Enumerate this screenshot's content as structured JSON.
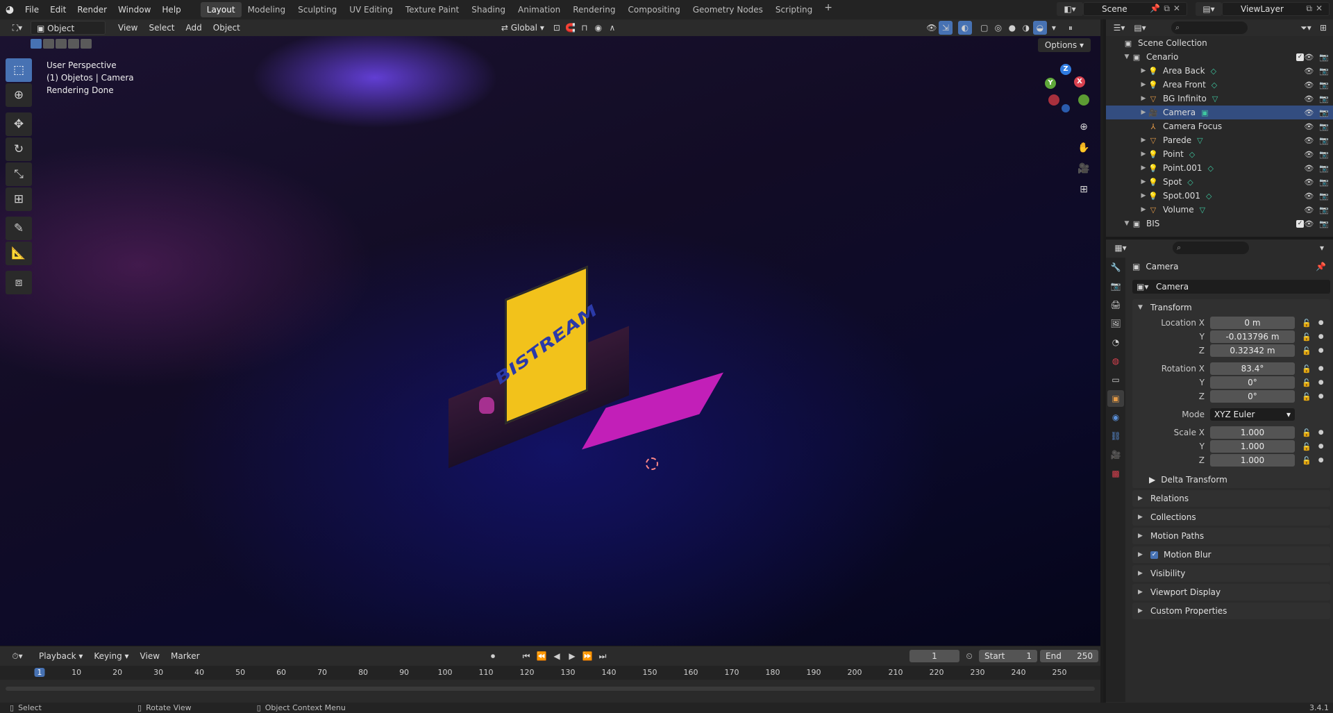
{
  "menus": [
    "File",
    "Edit",
    "Render",
    "Window",
    "Help"
  ],
  "workspaces": [
    "Layout",
    "Modeling",
    "Sculpting",
    "UV Editing",
    "Texture Paint",
    "Shading",
    "Animation",
    "Rendering",
    "Compositing",
    "Geometry Nodes",
    "Scripting"
  ],
  "active_workspace": "Layout",
  "add_workspace": "+",
  "scene": "Scene",
  "view_layer": "ViewLayer",
  "viewport_header": {
    "mode": "Object Mode",
    "menus": [
      "View",
      "Select",
      "Add",
      "Object"
    ],
    "orientation": "Global",
    "options": "Options"
  },
  "viewport_overlay": {
    "line1": "User Perspective",
    "line2": "(1) Objetos | Camera",
    "line3": "Rendering Done"
  },
  "scene_render": {
    "tv_text": "BISTREAM"
  },
  "gizmo": {
    "x": "X",
    "y": "Y",
    "z": "Z"
  },
  "timeline": {
    "menus": [
      "Playback",
      "Keying",
      "View",
      "Marker"
    ],
    "current_frame": "1",
    "start_label": "Start",
    "start_value": "1",
    "end_label": "End",
    "end_value": "250",
    "ticks": [
      "1",
      "10",
      "20",
      "30",
      "40",
      "50",
      "60",
      "70",
      "80",
      "90",
      "100",
      "110",
      "120",
      "130",
      "140",
      "150",
      "160",
      "170",
      "180",
      "190",
      "200",
      "210",
      "220",
      "230",
      "240",
      "250"
    ]
  },
  "statusbar": {
    "select": "Select",
    "rotate": "Rotate View",
    "context": "Object Context Menu",
    "version": "3.4.1"
  },
  "outliner": {
    "root": "Scene Collection",
    "collection": "Cenario",
    "items": [
      {
        "name": "Area Back",
        "type": "light"
      },
      {
        "name": "Area Front",
        "type": "light"
      },
      {
        "name": "BG Infinito",
        "type": "mesh"
      },
      {
        "name": "Camera",
        "type": "camera"
      },
      {
        "name": "Camera Focus",
        "type": "empty"
      },
      {
        "name": "Parede",
        "type": "mesh"
      },
      {
        "name": "Point",
        "type": "light"
      },
      {
        "name": "Point.001",
        "type": "light"
      },
      {
        "name": "Spot",
        "type": "light"
      },
      {
        "name": "Spot.001",
        "type": "light"
      },
      {
        "name": "Volume",
        "type": "mesh"
      }
    ],
    "collection2": "BIS"
  },
  "properties": {
    "object_title": "Camera",
    "object_name": "Camera",
    "transform_label": "Transform",
    "location": {
      "label": "Location X",
      "x": "0 m",
      "y": "-0.013796 m",
      "z": "0.32342 m"
    },
    "rotation": {
      "label": "Rotation X",
      "x": "83.4°",
      "y": "0°",
      "z": "0°"
    },
    "mode_label": "Mode",
    "mode_value": "XYZ Euler",
    "scale": {
      "label": "Scale X",
      "x": "1.000",
      "y": "1.000",
      "z": "1.000"
    },
    "axis_y": "Y",
    "axis_z": "Z",
    "delta_transform": "Delta Transform",
    "panels": [
      "Relations",
      "Collections",
      "Motion Paths",
      "Motion Blur",
      "Visibility",
      "Viewport Display",
      "Custom Properties"
    ]
  },
  "colors": {
    "accent": "#4772b3",
    "selected_row": "#334d80",
    "tv_yellow": "#f2c21b",
    "table_magenta": "#c21fb8"
  }
}
